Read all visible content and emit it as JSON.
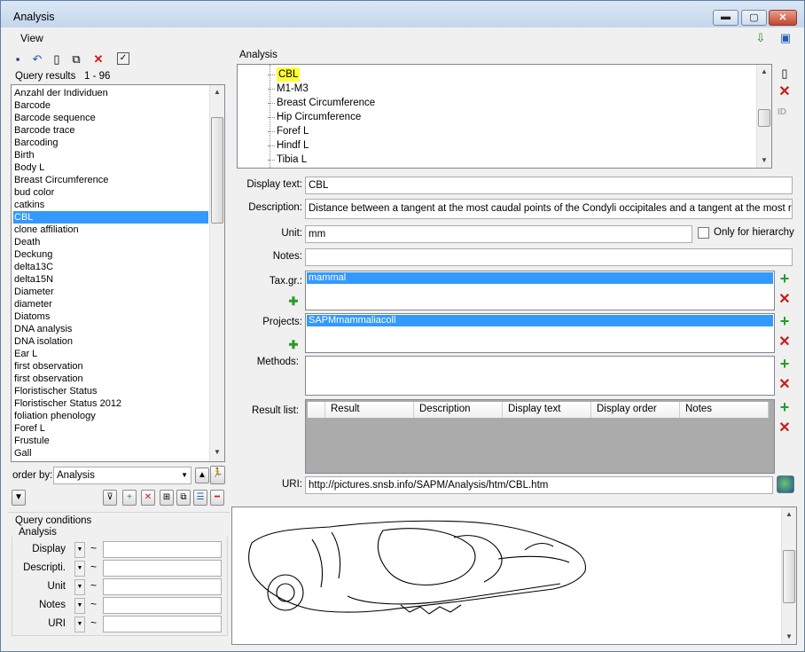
{
  "window": {
    "title": "Analysis",
    "minimize": "▬",
    "maximize": "▢",
    "close": "✕"
  },
  "menu": {
    "view": "View"
  },
  "query_results": {
    "label": "Query results",
    "range": "1 - 96",
    "items": [
      "Anzahl der Individuen",
      "Barcode",
      "Barcode sequence",
      "Barcode trace",
      "Barcoding",
      "Birth",
      "Body L",
      "Breast Circumference",
      "bud color",
      "catkins",
      "CBL",
      "clone affiliation",
      "Death",
      "Deckung",
      "delta13C",
      "delta15N",
      "Diameter",
      "diameter",
      "Diatoms",
      "DNA analysis",
      "DNA isolation",
      "Ear L",
      "first observation",
      "first observation",
      "Floristischer Status",
      "Floristischer Status 2012",
      "foliation phenology",
      "Foref L",
      "Frustule",
      "Gall"
    ],
    "selected": "CBL"
  },
  "order_by": {
    "label": "order by:",
    "value": "Analysis"
  },
  "query_conditions": {
    "title": "Query conditions",
    "group": "Analysis",
    "rows": [
      {
        "label": "Display",
        "tilde": "~",
        "value": ""
      },
      {
        "label": "Descripti.",
        "tilde": "~",
        "value": ""
      },
      {
        "label": "Unit",
        "tilde": "~",
        "value": ""
      },
      {
        "label": "Notes",
        "tilde": "~",
        "value": ""
      },
      {
        "label": "URI",
        "tilde": "~",
        "value": ""
      }
    ]
  },
  "analysis": {
    "group_title": "Analysis",
    "tree_items": [
      "CBL",
      "M1-M3",
      "Breast Circumference",
      "Hip Circumference",
      "Foref L",
      "Hindf L",
      "Tibia L"
    ],
    "selected_tree_item": "CBL",
    "id_label": "ID"
  },
  "form": {
    "display_text_label": "Display text:",
    "display_text": "CBL",
    "description_label": "Description:",
    "description": "Distance between a tangent at the most caudal points of the Condyli occipitales and a tangent at the most rostral",
    "unit_label": "Unit:",
    "unit": "mm",
    "only_hierarchy_label": "Only for hierarchy",
    "notes_label": "Notes:",
    "notes": "",
    "taxgr_label": "Tax.gr.:",
    "taxgr_items": [
      "mammal"
    ],
    "projects_label": "Projects:",
    "projects_items": [
      "SAPMmammaliacoll"
    ],
    "methods_label": "Methods:",
    "result_list_label": "Result list:",
    "result_columns": [
      "Result",
      "Description",
      "Display text",
      "Display order",
      "Notes"
    ],
    "uri_label": "URI:",
    "uri": "http://pictures.snsb.info/SAPM/Analysis/htm/CBL.htm"
  },
  "colors": {
    "selection": "#3399ff",
    "highlight": "#ffff33",
    "add_green": "#2a9a2a",
    "delete_red": "#d01818"
  }
}
